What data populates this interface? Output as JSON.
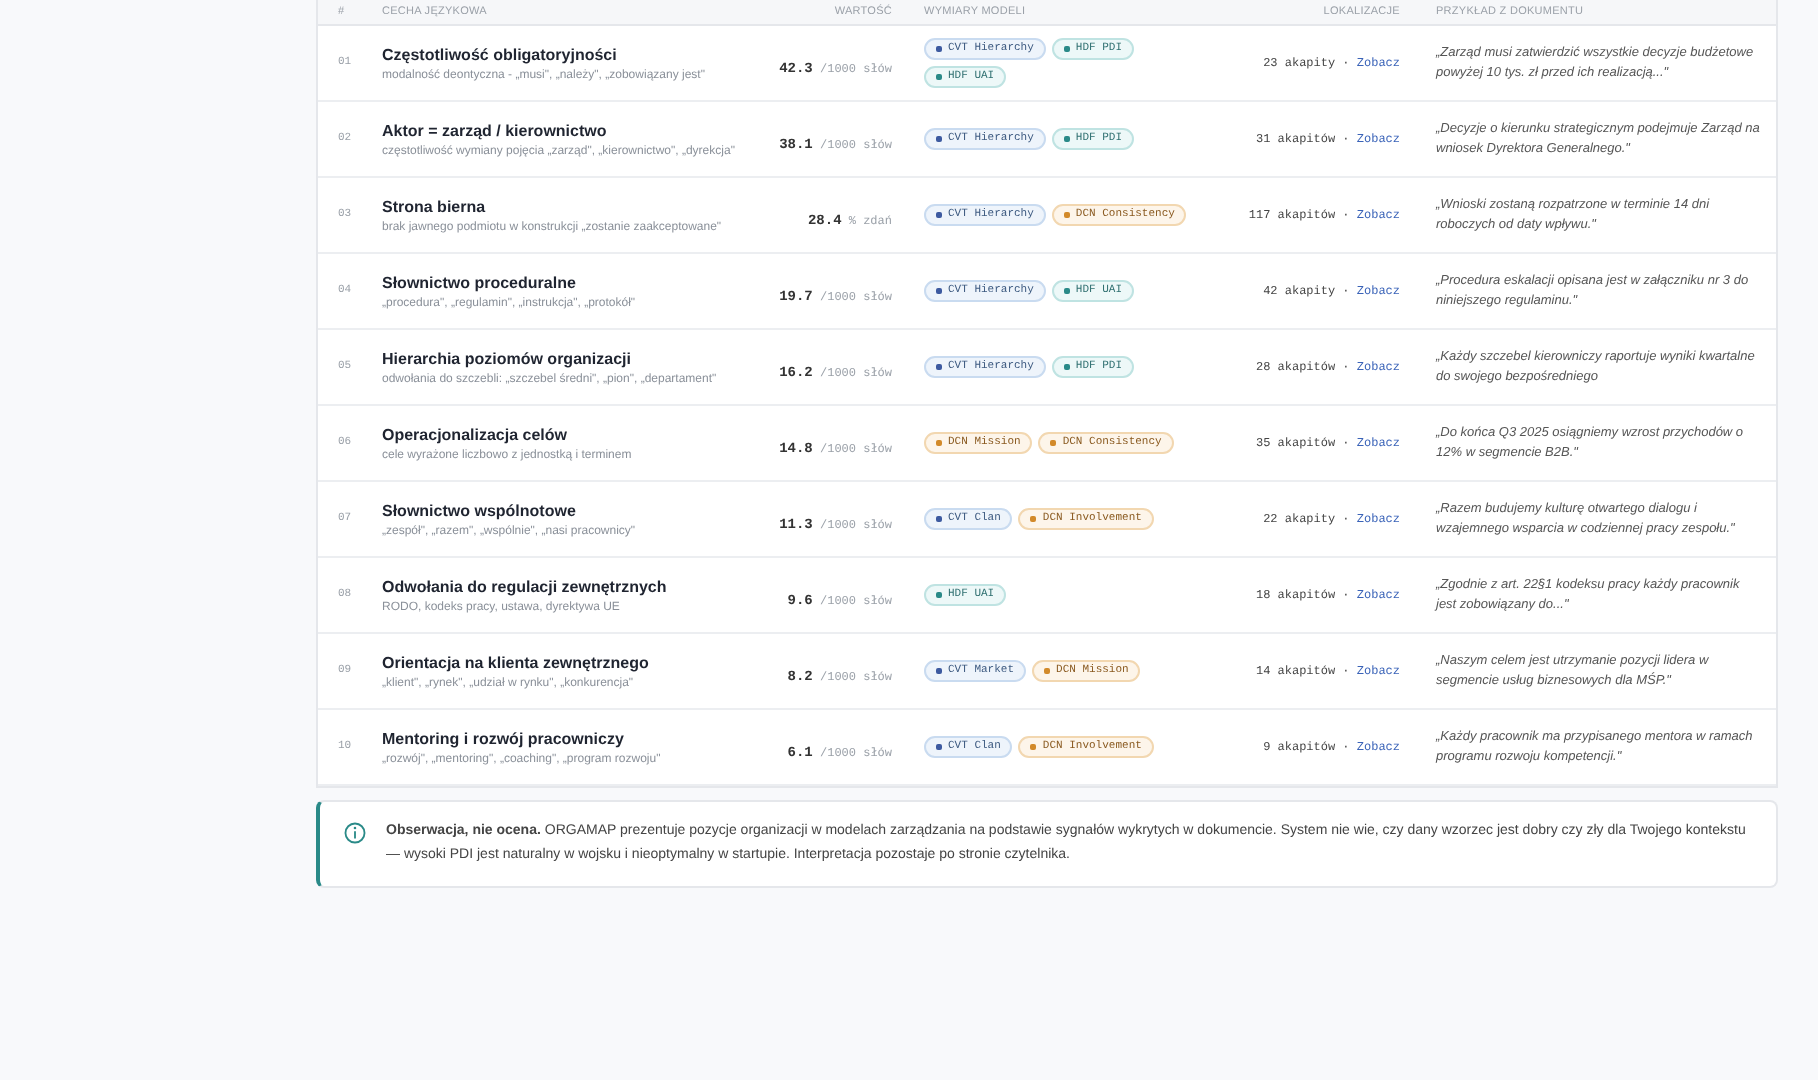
{
  "table": {
    "columns": [
      "#",
      "CECHA JĘZYKOWA",
      "WARTOŚĆ",
      "WYMIARY MODELI",
      "LOKALIZACJE",
      "PRZYKŁAD Z DOKUMENTU"
    ],
    "rows": [
      {
        "index": "01",
        "feature": "Częstotliwość obligatoryjności",
        "description": "modalność deontyczna - „musi\", „należy\", „zobowiązany jest\"",
        "value": "42.3",
        "unit": "/1000 słów",
        "tags": [
          {
            "label": "CVT Hierarchy",
            "kind": "cvt"
          },
          {
            "label": "HDF PDI",
            "kind": "hdf"
          },
          {
            "label": "HDF UAI",
            "kind": "hdf"
          }
        ],
        "count": "23 akapity ·",
        "link": "Zobacz",
        "example": "„Zarząd musi zatwierdzić wszystkie decyzje budżetowe powyżej 10 tys. zł przed ich realizacją...\""
      },
      {
        "index": "02",
        "feature": "Aktor = zarząd / kierownictwo",
        "description": "częstotliwość wymiany pojęcia „zarząd\", „kierownictwo\", „dyrekcja\"",
        "value": "38.1",
        "unit": "/1000 słów",
        "tags": [
          {
            "label": "CVT Hierarchy",
            "kind": "cvt"
          },
          {
            "label": "HDF PDI",
            "kind": "hdf"
          }
        ],
        "count": "31 akapitów ·",
        "link": "Zobacz",
        "example": "„Decyzje o kierunku strategicznym podejmuje Zarząd na wniosek Dyrektora Generalnego.\""
      },
      {
        "index": "03",
        "feature": "Strona bierna",
        "description": "brak jawnego podmiotu w konstrukcji „zostanie zaakceptowane\"",
        "value": "28.4",
        "unit": "% zdań",
        "tags": [
          {
            "label": "CVT Hierarchy",
            "kind": "cvt"
          },
          {
            "label": "DCN Consistency",
            "kind": "dcn"
          }
        ],
        "count": "117 akapitów ·",
        "link": "Zobacz",
        "example": "„Wnioski zostaną rozpatrzone w terminie 14 dni roboczych od daty wpływu.\""
      },
      {
        "index": "04",
        "feature": "Słownictwo proceduralne",
        "description": "„procedura\", „regulamin\", „instrukcja\", „protokół\"",
        "value": "19.7",
        "unit": "/1000 słów",
        "tags": [
          {
            "label": "CVT Hierarchy",
            "kind": "cvt"
          },
          {
            "label": "HDF UAI",
            "kind": "hdf"
          }
        ],
        "count": "42 akapity ·",
        "link": "Zobacz",
        "example": "„Procedura eskalacji opisana jest w załączniku nr 3 do niniejszego regulaminu.\""
      },
      {
        "index": "05",
        "feature": "Hierarchia poziomów organizacji",
        "description": "odwołania do szczebli: „szczebel średni\", „pion\", „departament\"",
        "value": "16.2",
        "unit": "/1000 słów",
        "tags": [
          {
            "label": "CVT Hierarchy",
            "kind": "cvt"
          },
          {
            "label": "HDF PDI",
            "kind": "hdf"
          }
        ],
        "count": "28 akapitów ·",
        "link": "Zobacz",
        "example": "„Każdy szczebel kierowniczy raportuje wyniki kwartalne do swojego bezpośredniego"
      },
      {
        "index": "06",
        "feature": "Operacjonalizacja celów",
        "description": "cele wyrażone liczbowo z jednostką i terminem",
        "value": "14.8",
        "unit": "/1000 słów",
        "tags": [
          {
            "label": "DCN Mission",
            "kind": "dcn"
          },
          {
            "label": "DCN Consistency",
            "kind": "dcn"
          }
        ],
        "count": "35 akapitów ·",
        "link": "Zobacz",
        "example": "„Do końca Q3 2025 osiągniemy wzrost przychodów o 12% w segmencie B2B.\""
      },
      {
        "index": "07",
        "feature": "Słownictwo wspólnotowe",
        "description": "„zespół\", „razem\", „wspólnie\", „nasi pracownicy\"",
        "value": "11.3",
        "unit": "/1000 słów",
        "tags": [
          {
            "label": "CVT Clan",
            "kind": "cvt"
          },
          {
            "label": "DCN Involvement",
            "kind": "dcn"
          }
        ],
        "count": "22 akapity ·",
        "link": "Zobacz",
        "example": "„Razem budujemy kulturę otwartego dialogu i wzajemnego wsparcia w codziennej pracy zespołu.\""
      },
      {
        "index": "08",
        "feature": "Odwołania do regulacji zewnętrznych",
        "description": "RODO, kodeks pracy, ustawa, dyrektywa UE",
        "value": "9.6",
        "unit": "/1000 słów",
        "tags": [
          {
            "label": "HDF UAI",
            "kind": "hdf"
          }
        ],
        "count": "18 akapitów ·",
        "link": "Zobacz",
        "example": "„Zgodnie z art. 22§1 kodeksu pracy każdy pracownik jest zobowiązany do...\""
      },
      {
        "index": "09",
        "feature": "Orientacja na klienta zewnętrznego",
        "description": "„klient\", „rynek\", „udział w rynku\", „konkurencja\"",
        "value": "8.2",
        "unit": "/1000 słów",
        "tags": [
          {
            "label": "CVT Market",
            "kind": "cvt"
          },
          {
            "label": "DCN Mission",
            "kind": "dcn"
          }
        ],
        "count": "14 akapitów ·",
        "link": "Zobacz",
        "example": "„Naszym celem jest utrzymanie pozycji lidera w segmencie usług biznesowych dla MŚP.\""
      },
      {
        "index": "10",
        "feature": "Mentoring i rozwój pracowniczy",
        "description": "„rozwój\", „mentoring\", „coaching\", „program rozwoju\"",
        "value": "6.1",
        "unit": "/1000 słów",
        "tags": [
          {
            "label": "CVT Clan",
            "kind": "cvt"
          },
          {
            "label": "DCN Involvement",
            "kind": "dcn"
          }
        ],
        "count": "9 akapitów ·",
        "link": "Zobacz",
        "example": "„Każdy pracownik ma przypisanego mentora w ramach programu rozwoju kompetencji.\""
      }
    ]
  },
  "note": {
    "text": "**Obserwacja, nie ocena.** ORGAMAP prezentuje pozycje organizacji w modelach zarządzania na podstawie sygnałów wykrytych w dokumencie. System nie wie, czy dany wzorzec jest dobry czy zły dla Twojego kontekstu — wysoki PDI jest naturalny w wojsku i nieoptymalny w startupie. Interpretacja pozostaje po stronie czytelnika."
  }
}
